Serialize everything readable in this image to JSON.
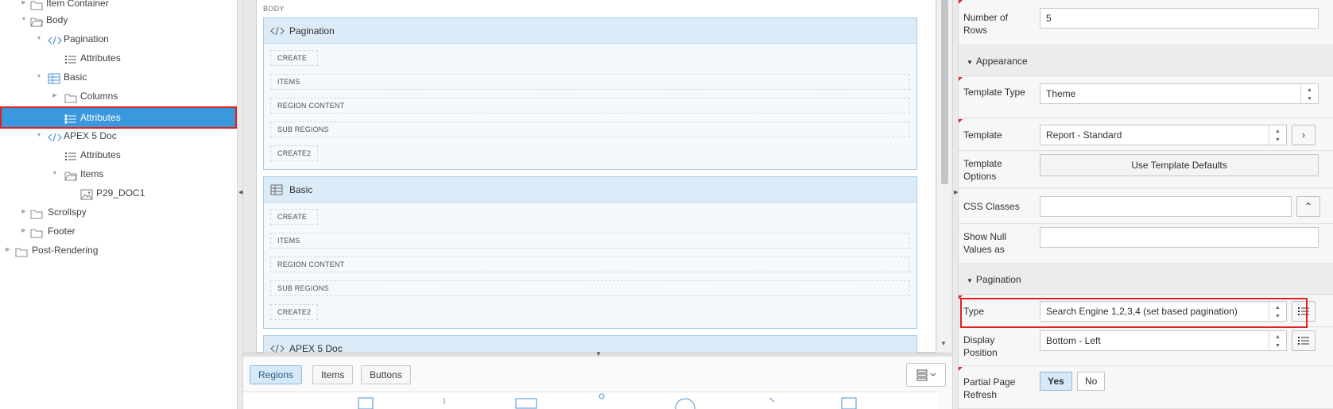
{
  "tree": {
    "items": [
      {
        "label": "Item Container",
        "icon": "folder-icon"
      },
      {
        "label": "Body",
        "icon": "folder-open-icon"
      },
      {
        "label": "Pagination",
        "icon": "code-icon"
      },
      {
        "label": "Attributes",
        "icon": "list-icon"
      },
      {
        "label": "Basic",
        "icon": "table-icon"
      },
      {
        "label": "Columns",
        "icon": "folder-icon"
      },
      {
        "label": "Attributes",
        "icon": "list-icon"
      },
      {
        "label": "APEX 5 Doc",
        "icon": "code-icon"
      },
      {
        "label": "Attributes",
        "icon": "list-icon"
      },
      {
        "label": "Items",
        "icon": "folder-open-icon"
      },
      {
        "label": "P29_DOC1",
        "icon": "image-item-icon"
      },
      {
        "label": "Scrollspy",
        "icon": "folder-icon"
      },
      {
        "label": "Footer",
        "icon": "folder-icon"
      },
      {
        "label": "Post-Rendering",
        "icon": "folder-icon"
      }
    ]
  },
  "layout_grid": {
    "body_label": "BODY",
    "regions": [
      {
        "title": "Pagination",
        "icon": "code-icon",
        "slots": [
          "CREATE",
          "ITEMS",
          "REGION CONTENT",
          "SUB REGIONS",
          "CREATE2"
        ]
      },
      {
        "title": "Basic",
        "icon": "table-icon",
        "slots": [
          "CREATE",
          "ITEMS",
          "REGION CONTENT",
          "SUB REGIONS",
          "CREATE2"
        ]
      },
      {
        "title": "APEX 5 Doc",
        "icon": "code-icon",
        "slots": []
      }
    ]
  },
  "gallery": {
    "tabs": [
      "Regions",
      "Items",
      "Buttons"
    ],
    "active_tab": "Regions"
  },
  "properties": {
    "number_of_rows": {
      "label": "Number of Rows",
      "value": "5"
    },
    "appearance": {
      "group_title": "Appearance",
      "template_type": {
        "label": "Template Type",
        "value": "Theme"
      },
      "template": {
        "label": "Template",
        "value": "Report - Standard"
      },
      "template_options": {
        "label": "Template Options",
        "button": "Use Template Defaults"
      },
      "css_classes": {
        "label": "CSS Classes",
        "value": ""
      },
      "show_null": {
        "label": "Show Null Values as",
        "value": ""
      }
    },
    "pagination": {
      "group_title": "Pagination",
      "type": {
        "label": "Type",
        "value": "Search Engine 1,2,3,4 (set based pagination)"
      },
      "display_position": {
        "label": "Display Position",
        "value": "Bottom - Left"
      },
      "partial_refresh": {
        "label": "Partial Page Refresh",
        "yes": "Yes",
        "no": "No",
        "selected": "Yes"
      }
    }
  },
  "colors": {
    "selection": "#3a98dd",
    "highlight_border": "#e02020",
    "region_header": "#dcebf8"
  }
}
